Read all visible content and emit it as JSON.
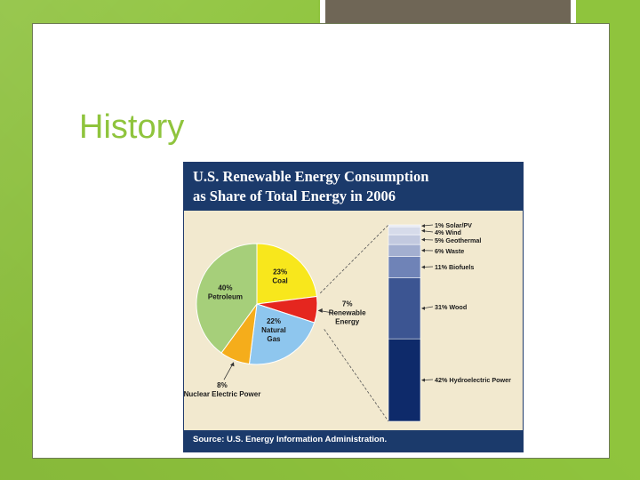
{
  "slide": {
    "title": "History"
  },
  "figure": {
    "title_line1": "U.S. Renewable Energy Consumption",
    "title_line2": "as Share of Total Energy in 2006",
    "source": "Source: U.S. Energy Information Administration.",
    "colors": {
      "header": "#1b3a6b",
      "panel": "#f2e9cf",
      "page_background": "#8fc43d"
    }
  },
  "chart_data": [
    {
      "type": "pie",
      "title": "",
      "slices": [
        {
          "label_pct": "23%",
          "label_name": "Coal",
          "value": 23,
          "color": "#f8e71c"
        },
        {
          "label_pct": "7%",
          "label_name": "Renewable",
          "label_name2": "Energy",
          "value": 7,
          "color": "#e5261f"
        },
        {
          "label_pct": "22%",
          "label_name": "Natural",
          "label_name2": "Gas",
          "value": 22,
          "color": "#8ec6ee"
        },
        {
          "label_pct": "8%",
          "label_name": "Nuclear Electric Power",
          "value": 8,
          "color": "#f5ad1b"
        },
        {
          "label_pct": "40%",
          "label_name": "Petroleum",
          "value": 40,
          "color": "#a6cf7a"
        }
      ]
    },
    {
      "type": "bar",
      "stacked": true,
      "title": "",
      "segments": [
        {
          "label": "42% Hydroelectric Power",
          "value": 42,
          "color": "#0e2a6a"
        },
        {
          "label": "31% Wood",
          "value": 31,
          "color": "#3c5592"
        },
        {
          "label": "11% Biofuels",
          "value": 11,
          "color": "#6f83b7"
        },
        {
          "label": "6% Waste",
          "value": 6,
          "color": "#a3afd0"
        },
        {
          "label": "5% Geothermal",
          "value": 5,
          "color": "#c2c9df"
        },
        {
          "label": "4% Wind",
          "value": 4,
          "color": "#d6dbea"
        },
        {
          "label": "1% Solar/PV",
          "value": 1,
          "color": "#e8ebf3"
        }
      ]
    }
  ]
}
